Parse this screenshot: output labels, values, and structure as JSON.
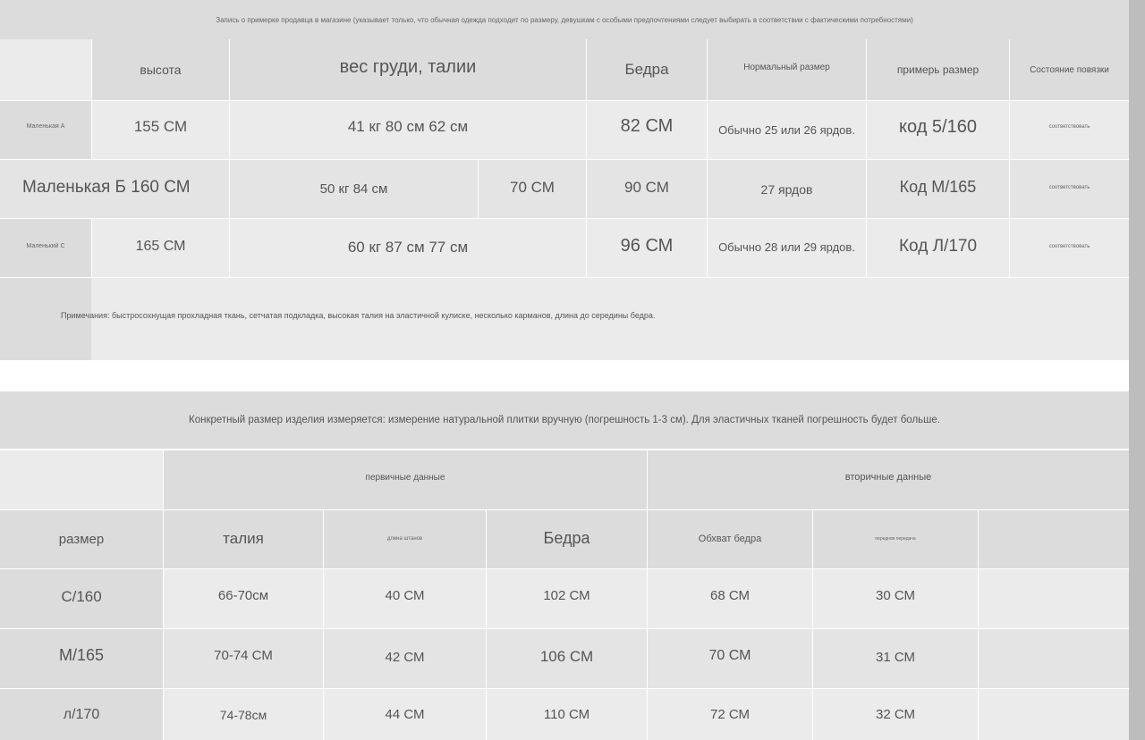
{
  "top_note": "Запись о примерке продавца в магазине (указывает только, что обычная одежда подходит по размеру, девушкам с особыми предпочтениями следует выбирать в соответствии с фактическими потребностями)",
  "table1": {
    "headers": {
      "height": "высота",
      "weight_chest_waist": "вес груди, талии",
      "hips": "Бедра",
      "normal_size": "Нормальный размер",
      "try_size": "примерь размер",
      "bandage_state": "Состояние повязки"
    },
    "rows": [
      {
        "label": "Маленькая А",
        "height": "155 СМ",
        "measures": "41 кг 80 см 62 см",
        "waist": "",
        "hips": "82 СМ",
        "normal": "Обычно 25 или 26 ярдов.",
        "size": "код 5/160",
        "state": "соответствовать"
      },
      {
        "label": "Маленькая Б 160 СМ",
        "height": "",
        "measures": "50 кг 84 см",
        "waist": "70 СМ",
        "hips": "90 СМ",
        "normal": "27 ярдов",
        "size": "Код М/165",
        "state": "соответствовать"
      },
      {
        "label": "Маленький С",
        "height": "165 СМ",
        "measures": "60 кг 87 см 77 см",
        "waist": "",
        "hips": "96 СМ",
        "normal": "Обычно 28 или 29 ярдов.",
        "size": "Код Л/170",
        "state": "соответствовать"
      }
    ],
    "notes": "Примечания: быстросохнущая прохладная ткань, сетчатая подкладка, высокая талия на эластичной кулиске, несколько карманов, длина до середины бедра."
  },
  "table2": {
    "intro": "Конкретный размер изделия измеряется: измерение натуральной плитки вручную (погрешность 1-3 см). Для эластичных тканей погрешность будет больше.",
    "group_primary": "первичные данные",
    "group_secondary": "вторичные данные",
    "headers": {
      "size": "размер",
      "waist": "талия",
      "pants_length": "длина штанов",
      "hips": "Бедра",
      "thigh": "Обхват бедра",
      "front_rise": "передняя передача"
    },
    "rows": [
      {
        "size": "С/160",
        "waist": "66-70см",
        "length": "40 СМ",
        "hips": "102 СМ",
        "thigh": "68 СМ",
        "rise": "30 СМ"
      },
      {
        "size": "М/165",
        "waist": "70-74 СМ",
        "length": "42 СМ",
        "hips": "106 СМ",
        "thigh": "70 СМ",
        "rise": "31 СМ"
      },
      {
        "size": "л/170",
        "waist": "74-78см",
        "length": "44 СМ",
        "hips": "110 СМ",
        "thigh": "72 СМ",
        "rise": "32 СМ"
      }
    ]
  }
}
